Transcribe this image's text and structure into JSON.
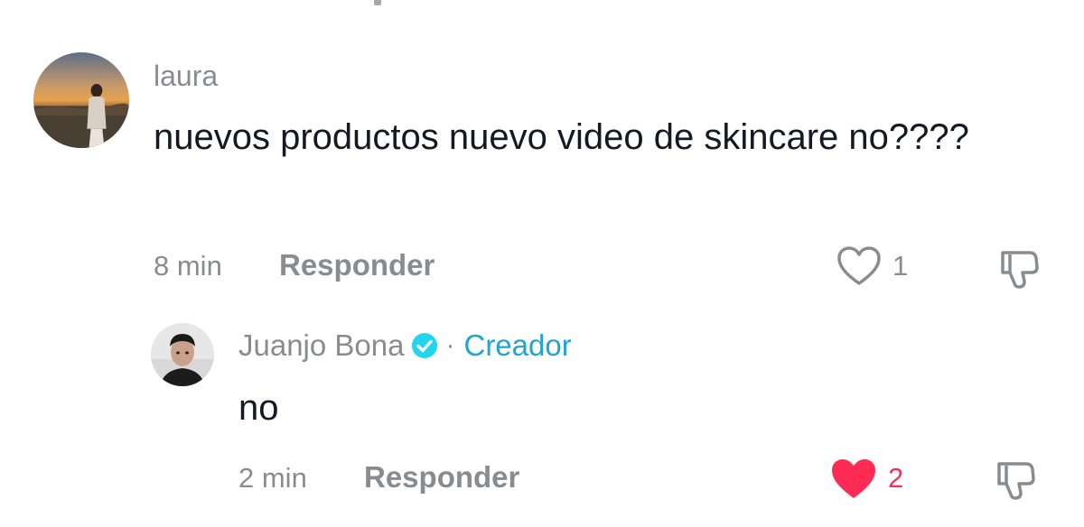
{
  "comment": {
    "username": "laura",
    "text": "nuevos productos nuevo video de skincare no????",
    "time": "8 min",
    "reply_label": "Responder",
    "likes": "1",
    "liked": false,
    "avatar_icon": "user-avatar-sunset-photo",
    "like_icon": "heart-outline-icon",
    "dislike_icon": "thumbs-down-icon"
  },
  "reply": {
    "username": "Juanjo Bona",
    "verified_icon": "verified-badge-icon",
    "separator": "·",
    "badge": "Creador",
    "text": "no",
    "time": "2 min",
    "reply_label": "Responder",
    "likes": "2",
    "liked": true,
    "avatar_icon": "user-avatar-portrait-photo",
    "like_icon": "heart-filled-icon",
    "dislike_icon": "thumbs-down-icon"
  },
  "colors": {
    "text_primary": "#161823",
    "text_secondary": "#8a8b91",
    "creator_accent": "#20a5cf",
    "like_active": "#fe2c55"
  }
}
